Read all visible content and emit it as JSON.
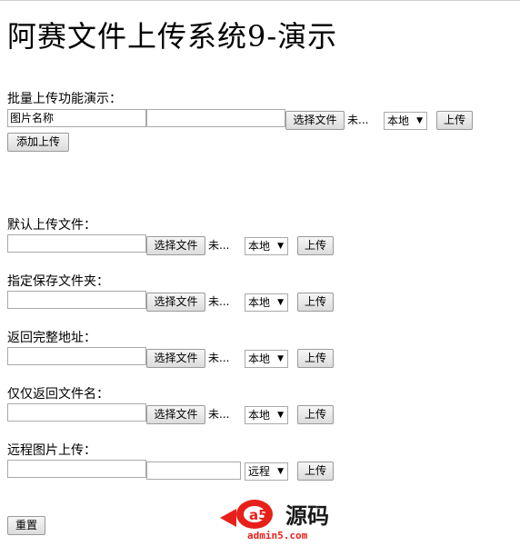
{
  "title": "阿赛文件上传系统9-演示",
  "batch": {
    "label": "批量上传功能演示：",
    "name_field_value": "图片名称",
    "path_field_value": "",
    "choose_file": "选择文件",
    "file_status": "未...",
    "select_value": "本地",
    "upload": "上传",
    "add_upload": "添加上传"
  },
  "sections": [
    {
      "label": "默认上传文件：",
      "choose_file": "选择文件",
      "file_status": "未...",
      "select_value": "本地",
      "upload": "上传"
    },
    {
      "label": "指定保存文件夹：",
      "choose_file": "选择文件",
      "file_status": "未...",
      "select_value": "本地",
      "upload": "上传"
    },
    {
      "label": "返回完整地址：",
      "choose_file": "选择文件",
      "file_status": "未...",
      "select_value": "本地",
      "upload": "上传"
    },
    {
      "label": "仅仅返回文件名：",
      "choose_file": "选择文件",
      "file_status": "未...",
      "select_value": "本地",
      "upload": "上传"
    }
  ],
  "remote": {
    "label": "远程图片上传：",
    "select_value": "远程",
    "upload": "上传"
  },
  "reset": "重置",
  "logo": {
    "text_left": "a5",
    "text_right": "源码",
    "url": "admin5.com",
    "accent": "#e8201a"
  }
}
